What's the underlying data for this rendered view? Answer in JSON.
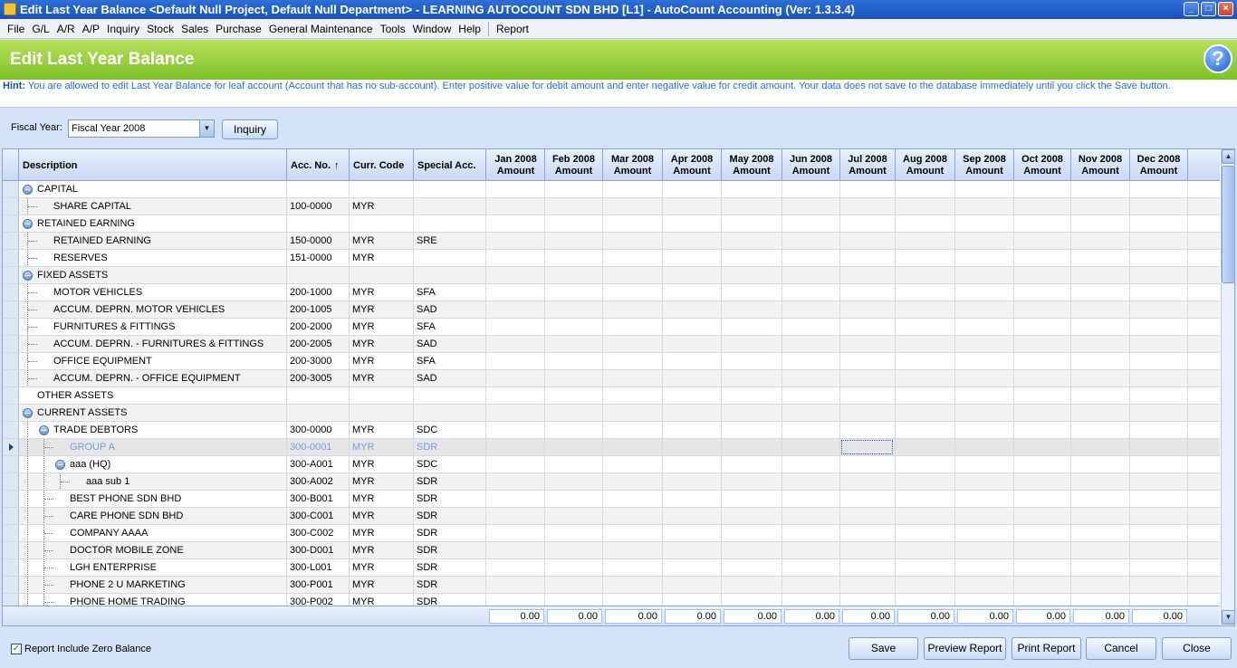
{
  "window": {
    "title": "Edit Last Year Balance <Default Null Project, Default Null Department> - LEARNING AUTOCOUNT SDN BHD [L1] - AutoCount Accounting (Ver: 1.3.3.4)",
    "min": "_",
    "max": "□",
    "close": "×"
  },
  "menu": [
    "File",
    "G/L",
    "A/R",
    "A/P",
    "Inquiry",
    "Stock",
    "Sales",
    "Purchase",
    "General Maintenance",
    "Tools",
    "Window",
    "Help"
  ],
  "menu_extra": "Report",
  "banner": {
    "title": "Edit Last Year Balance",
    "help": "?"
  },
  "hint": {
    "label": "Hint:",
    "text": "You are allowed to edit Last Year Balance for leaf account (Account that has no sub-account). Enter positive value for debit amount and enter negative value for credit amount. Your data does not save to the database immediately until you click the Save button."
  },
  "fiscal": {
    "label": "Fiscal Year:",
    "value": "Fiscal Year 2008",
    "inquiry": "Inquiry"
  },
  "columns": {
    "description": "Description",
    "accno": "Acc. No.",
    "sort_glyph": "↑",
    "curr": "Curr. Code",
    "special": "Special Acc.",
    "months": [
      [
        "Jan 2008",
        "Amount"
      ],
      [
        "Feb 2008",
        "Amount"
      ],
      [
        "Mar 2008",
        "Amount"
      ],
      [
        "Apr 2008",
        "Amount"
      ],
      [
        "May 2008",
        "Amount"
      ],
      [
        "Jun 2008",
        "Amount"
      ],
      [
        "Jul 2008",
        "Amount"
      ],
      [
        "Aug 2008",
        "Amount"
      ],
      [
        "Sep 2008",
        "Amount"
      ],
      [
        "Oct 2008",
        "Amount"
      ],
      [
        "Nov 2008",
        "Amount"
      ],
      [
        "Dec 2008",
        "Amount"
      ]
    ]
  },
  "rows": [
    {
      "desc": "CAPITAL",
      "acc": "",
      "curr": "",
      "special": "",
      "level": 0,
      "expand": true
    },
    {
      "desc": "SHARE CAPITAL",
      "acc": "100-0000",
      "curr": "MYR",
      "special": "",
      "level": 1
    },
    {
      "desc": "RETAINED EARNING",
      "acc": "",
      "curr": "",
      "special": "",
      "level": 0,
      "expand": true
    },
    {
      "desc": "RETAINED EARNING",
      "acc": "150-0000",
      "curr": "MYR",
      "special": "SRE",
      "level": 1
    },
    {
      "desc": "RESERVES",
      "acc": "151-0000",
      "curr": "MYR",
      "special": "",
      "level": 1
    },
    {
      "desc": "FIXED ASSETS",
      "acc": "",
      "curr": "",
      "special": "",
      "level": 0,
      "expand": true
    },
    {
      "desc": "MOTOR VEHICLES",
      "acc": "200-1000",
      "curr": "MYR",
      "special": "SFA",
      "level": 1
    },
    {
      "desc": "ACCUM. DEPRN. MOTOR VEHICLES",
      "acc": "200-1005",
      "curr": "MYR",
      "special": "SAD",
      "level": 1
    },
    {
      "desc": "FURNITURES & FITTINGS",
      "acc": "200-2000",
      "curr": "MYR",
      "special": "SFA",
      "level": 1
    },
    {
      "desc": "ACCUM. DEPRN. - FURNITURES & FITTINGS",
      "acc": "200-2005",
      "curr": "MYR",
      "special": "SAD",
      "level": 1
    },
    {
      "desc": "OFFICE EQUIPMENT",
      "acc": "200-3000",
      "curr": "MYR",
      "special": "SFA",
      "level": 1
    },
    {
      "desc": "ACCUM. DEPRN. - OFFICE EQUIPMENT",
      "acc": "200-3005",
      "curr": "MYR",
      "special": "SAD",
      "level": 1
    },
    {
      "desc": "OTHER ASSETS",
      "acc": "",
      "curr": "",
      "special": "",
      "level": 0
    },
    {
      "desc": "CURRENT ASSETS",
      "acc": "",
      "curr": "",
      "special": "",
      "level": 0,
      "expand": true
    },
    {
      "desc": "TRADE DEBTORS",
      "acc": "300-0000",
      "curr": "MYR",
      "special": "SDC",
      "level": 1,
      "expand": true
    },
    {
      "desc": "GROUP A",
      "acc": "300-0001",
      "curr": "MYR",
      "special": "SDR",
      "level": 2,
      "selected": true
    },
    {
      "desc": "aaa (HQ)",
      "acc": "300-A001",
      "curr": "MYR",
      "special": "SDC",
      "level": 2,
      "expand": true
    },
    {
      "desc": "aaa sub 1",
      "acc": "300-A002",
      "curr": "MYR",
      "special": "SDR",
      "level": 3
    },
    {
      "desc": "BEST PHONE SDN BHD",
      "acc": "300-B001",
      "curr": "MYR",
      "special": "SDR",
      "level": 2
    },
    {
      "desc": "CARE PHONE SDN BHD",
      "acc": "300-C001",
      "curr": "MYR",
      "special": "SDR",
      "level": 2
    },
    {
      "desc": "COMPANY AAAA",
      "acc": "300-C002",
      "curr": "MYR",
      "special": "SDR",
      "level": 2
    },
    {
      "desc": "DOCTOR MOBILE ZONE",
      "acc": "300-D001",
      "curr": "MYR",
      "special": "SDR",
      "level": 2
    },
    {
      "desc": "LGH ENTERPRISE",
      "acc": "300-L001",
      "curr": "MYR",
      "special": "SDR",
      "level": 2
    },
    {
      "desc": "PHONE 2 U MARKETING",
      "acc": "300-P001",
      "curr": "MYR",
      "special": "SDR",
      "level": 2
    },
    {
      "desc": "PHONE HOME TRADING",
      "acc": "300-P002",
      "curr": "MYR",
      "special": "SDR",
      "level": 2
    }
  ],
  "totals": [
    "0.00",
    "0.00",
    "0.00",
    "0.00",
    "0.00",
    "0.00",
    "0.00",
    "0.00",
    "0.00",
    "0.00",
    "0.00",
    "0.00"
  ],
  "bottom": {
    "checkbox_label": "Report Include Zero Balance",
    "checkbox_checked": true,
    "checkmark": "✓",
    "save": "Save",
    "preview": "Preview Report",
    "print": "Print Report",
    "cancel": "Cancel",
    "close": "Close"
  },
  "scroll": {
    "up": "▲",
    "down": "▼",
    "dropdown": "▼"
  }
}
